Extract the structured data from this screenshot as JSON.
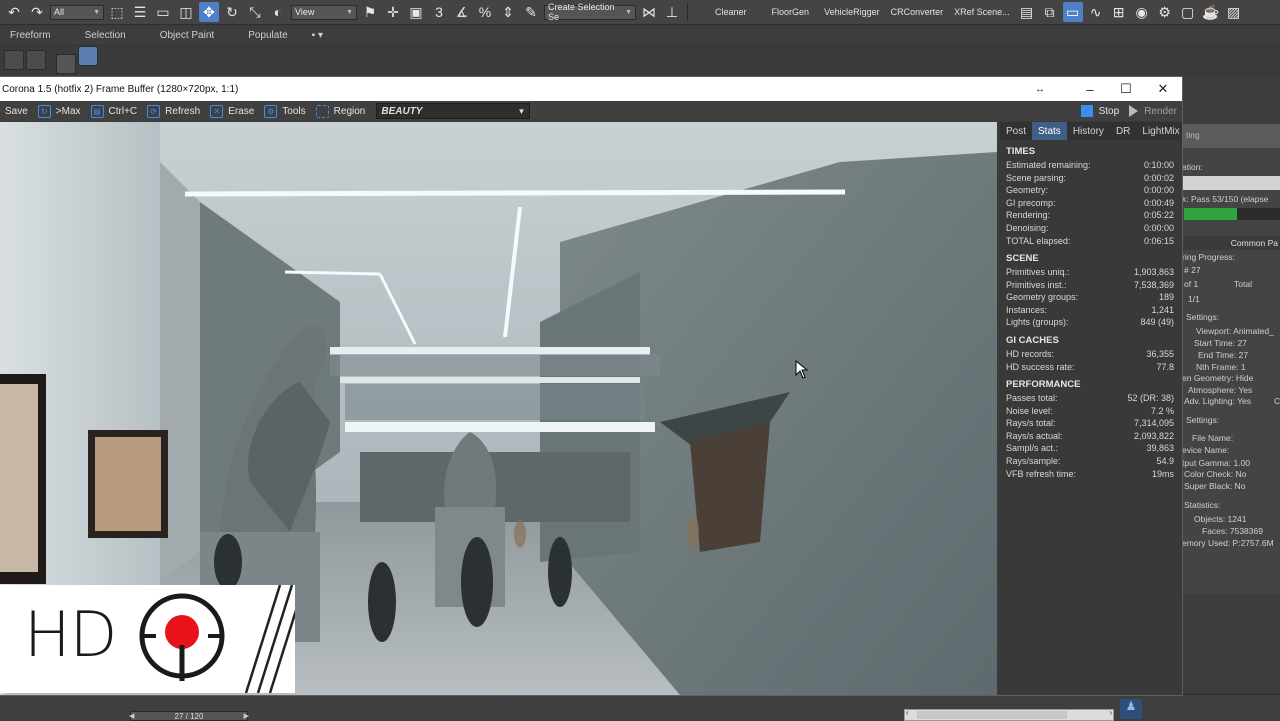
{
  "max_toolbar": {
    "selection_filter": "All",
    "ref_coord": "View",
    "named_selection_placeholder": "Create Selection Se",
    "scripts": [
      "Cleaner",
      "FloorGen",
      "VehicleRigger",
      "CRConverter",
      "XRef Scene..."
    ]
  },
  "ribbon_tabs": [
    "Freeform",
    "Selection",
    "Object Paint",
    "Populate"
  ],
  "vfb": {
    "title": "Corona 1.5 (hotfix 2) Frame Buffer (1280×720px, 1:1)",
    "toolbar": {
      "save": "Save",
      "to_max": ">Max",
      "copy": "Ctrl+C",
      "refresh": "Refresh",
      "erase": "Erase",
      "tools": "Tools",
      "region": "Region",
      "channel": "BEAUTY",
      "stop": "Stop",
      "render": "Render"
    },
    "panel_tabs": [
      "Post",
      "Stats",
      "History",
      "DR",
      "LightMix"
    ],
    "active_tab": "Stats",
    "stats": {
      "times": {
        "title": "TIMES",
        "rows": [
          {
            "label": "Estimated remaining:",
            "value": "0:10:00"
          },
          {
            "label": "Scene parsing:",
            "value": "0:00:02"
          },
          {
            "label": "Geometry:",
            "value": "0:00:00"
          },
          {
            "label": "GI precomp:",
            "value": "0:00:49"
          },
          {
            "label": "Rendering:",
            "value": "0:05:22"
          },
          {
            "label": "Denoising:",
            "value": "0:00:00"
          },
          {
            "label": "TOTAL elapsed:",
            "value": "0:06:15"
          }
        ]
      },
      "scene": {
        "title": "SCENE",
        "rows": [
          {
            "label": "Primitives uniq.:",
            "value": "1,903,863"
          },
          {
            "label": "Primitives inst.:",
            "value": "7,538,369"
          },
          {
            "label": "Geometry groups:",
            "value": "189"
          },
          {
            "label": "Instances:",
            "value": "1,241"
          },
          {
            "label": "Lights (groups):",
            "value": "849 (49)"
          }
        ]
      },
      "gi_caches": {
        "title": "GI CACHES",
        "rows": [
          {
            "label": "HD records:",
            "value": "36,355"
          },
          {
            "label": "HD success rate:",
            "value": "77.8"
          }
        ]
      },
      "performance": {
        "title": "PERFORMANCE",
        "rows": [
          {
            "label": "Passes total:",
            "value": "52 (DR: 38)"
          },
          {
            "label": "Noise level:",
            "value": "7.2 %"
          },
          {
            "label": "Rays/s total:",
            "value": "7,314,095"
          },
          {
            "label": "Rays/s actual:",
            "value": "2,093,822"
          },
          {
            "label": "Sampl/s act.:",
            "value": "39,863"
          },
          {
            "label": "Rays/sample:",
            "value": "54.9"
          },
          {
            "label": "VFB refresh time:",
            "value": "19ms"
          }
        ]
      }
    }
  },
  "render_setup_panel": {
    "line_top": "ting",
    "line_ation": "ation:",
    "pass_text": "k:   Pass 53/150 (elapse",
    "progress_fraction": 0.55,
    "common_tab": "Common Pa",
    "progress_title": "ring Progress:",
    "frame_hash": "#  27",
    "of_line": "of 1",
    "total": "Total",
    "ratio": "1/1",
    "settings1": "Settings:",
    "viewport": "Viewport:  Animated_",
    "start_time": "Start Time:  27",
    "end_time": "End Time:  27",
    "nth_frame": "Nth Frame:  1",
    "hidden_geometry": "en Geometry:  Hide",
    "atmosphere": "Atmosphere:  Yes",
    "adv_lighting": "Adv. Lighting:  Yes",
    "adv_extra": "C",
    "settings2": "Settings:",
    "file_name": "File Name:",
    "device_name": "evice Name:",
    "output_gamma": "tput Gamma:  1.00",
    "color_check": "Color Check:  No",
    "super_black": "Super Black:  No",
    "statistics": "Statistics:",
    "objects": "Objects:  1241",
    "faces": "Faces:  7538369",
    "memory": "emory Used:  P:2757.6M"
  },
  "timeline": {
    "frame_readout": "27 / 120"
  },
  "overlay_logo": {
    "text": "HD"
  },
  "colors": {
    "accent_blue": "#3f8cf0",
    "progress_green": "#2fa33e",
    "logo_red": "#e8131b"
  }
}
